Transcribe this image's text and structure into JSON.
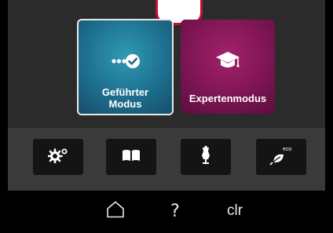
{
  "modes": {
    "guided": {
      "label": "Geführter Modus",
      "icon": "guided-progress-check-icon"
    },
    "expert": {
      "label": "Expertenmodus",
      "icon": "graduation-cap-icon"
    }
  },
  "toolbar": {
    "settings": {
      "icon": "gears-icon"
    },
    "tutorial": {
      "icon": "open-book-icon"
    },
    "sewing_consultant": {
      "icon": "dress-form-icon"
    },
    "eco": {
      "icon": "eco-leaf-icon",
      "badge": "eco"
    }
  },
  "nav": {
    "home": {
      "icon": "home-icon"
    },
    "help": {
      "label": "?"
    },
    "clear": {
      "label": "clr"
    }
  },
  "colors": {
    "guided_tile": "#1e6f8f",
    "expert_tile": "#7a1452",
    "accent_red": "#c8102e"
  }
}
